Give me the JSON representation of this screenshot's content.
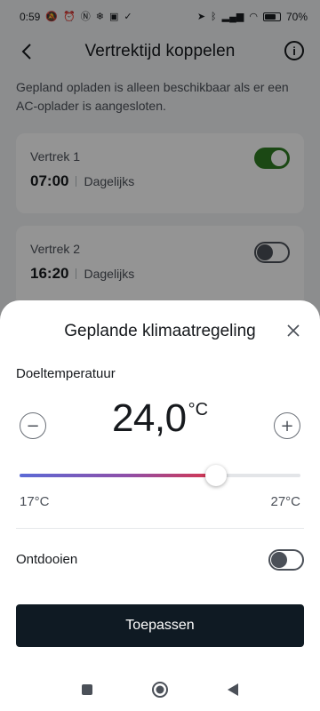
{
  "status_bar": {
    "time": "0:59",
    "left_icons": [
      "mute-icon",
      "alarm-icon",
      "nfc-icon",
      "snowflake-icon",
      "calendar-icon",
      "check-icon"
    ],
    "right_icons": [
      "location-icon",
      "bluetooth-icon",
      "signal-icon",
      "wifi-icon",
      "battery-icon"
    ],
    "battery": "70%"
  },
  "header": {
    "title": "Vertrektijd koppelen",
    "info_glyph": "i"
  },
  "notice": "Gepland opladen is alleen beschikbaar als er een AC-oplader is aangesloten.",
  "departures": [
    {
      "label": "Vertrek 1",
      "time": "07:00",
      "frequency": "Dagelijks",
      "enabled": true
    },
    {
      "label": "Vertrek 2",
      "time": "16:20",
      "frequency": "Dagelijks",
      "enabled": false
    }
  ],
  "sheet": {
    "title": "Geplande klimaatregeling",
    "target_label": "Doeltemperatuur",
    "temperature": "24,0",
    "unit": "°C",
    "decrease_glyph": "−",
    "increase_glyph": "+",
    "range_min": "17°C",
    "range_max": "27°C",
    "slider_fraction": 0.7,
    "defrost_label": "Ontdooien",
    "defrost_enabled": false,
    "apply_label": "Toepassen"
  },
  "colors": {
    "toggle_on": "#2f7d23",
    "apply_button": "#0f1a23",
    "slider_start": "#5b6ad6",
    "slider_end": "#d8354c"
  },
  "nav": [
    "recents-icon",
    "home-icon",
    "back-icon"
  ]
}
